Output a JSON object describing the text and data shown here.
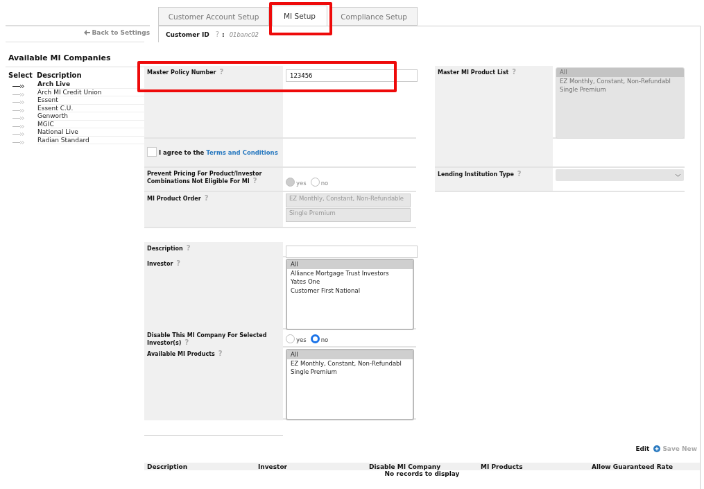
{
  "tabs": [
    {
      "label": "Customer Account Setup",
      "selected": false
    },
    {
      "label": "MI Setup",
      "selected": true
    },
    {
      "label": "Compliance Setup",
      "selected": false
    }
  ],
  "back_link": "Back to Settings",
  "customer_id": {
    "label": "Customer ID",
    "help": "?",
    "separator": ":",
    "value": "01banc02"
  },
  "sidebar": {
    "title": "Available MI Companies",
    "columns": [
      "Select",
      "Description"
    ],
    "items": [
      {
        "label": "Arch Live",
        "selected": true
      },
      {
        "label": "Arch MI Credit Union",
        "selected": false
      },
      {
        "label": "Essent",
        "selected": false
      },
      {
        "label": "Essent C.U.",
        "selected": false
      },
      {
        "label": "Genworth",
        "selected": false
      },
      {
        "label": "MGIC",
        "selected": false
      },
      {
        "label": "National Live",
        "selected": false
      },
      {
        "label": "Radian Standard",
        "selected": false
      }
    ]
  },
  "company_settings": {
    "left": [
      {
        "kind": "text",
        "label": "Master Policy Number",
        "help": "?",
        "value": "123456"
      },
      {
        "kind": "checkbox",
        "text": "I agree to the ",
        "link": "Terms and Conditions",
        "checked": false
      },
      {
        "kind": "radio",
        "label": "Prevent Pricing For Product/Investor Combinations Not Eligible For MI",
        "help": "?",
        "disabled": true,
        "options": [
          {
            "label": "yes",
            "selected": true
          },
          {
            "label": "no",
            "selected": false
          }
        ]
      },
      {
        "kind": "order",
        "label": "MI Product Order",
        "help": "?",
        "items": [
          "EZ Monthly, Constant, Non-Refundable",
          "Single Premium"
        ]
      }
    ],
    "right": [
      {
        "kind": "listbox",
        "label": "Master MI Product List",
        "help": "?",
        "disabled": true,
        "options": [
          {
            "label": "All",
            "selected": true
          },
          {
            "label": "EZ Monthly, Constant, Non-Refundabl",
            "selected": false
          },
          {
            "label": "Single Premium",
            "selected": false
          }
        ]
      },
      {
        "kind": "blank"
      },
      {
        "kind": "select",
        "label": "Lending Institution Type",
        "help": "?",
        "disabled": true
      }
    ]
  },
  "investor_settings": [
    {
      "kind": "text",
      "label": "Description",
      "help": "?"
    },
    {
      "kind": "listbox",
      "label": "Investor",
      "help": "?",
      "disabled": false,
      "options": [
        {
          "label": "All",
          "selected": true
        },
        {
          "label": "Alliance Mortgage Trust Investors",
          "selected": false
        },
        {
          "label": "Yates One",
          "selected": false
        },
        {
          "label": "Customer First National",
          "selected": false
        }
      ]
    },
    {
      "kind": "radio",
      "label": "Disable This MI Company For Selected Investor(s)",
      "help": "?",
      "disabled": false,
      "options": [
        {
          "label": "yes",
          "selected": false
        },
        {
          "label": "no",
          "selected": true
        }
      ]
    },
    {
      "kind": "listbox",
      "label": "Available MI Products",
      "help": "?",
      "disabled": false,
      "options": [
        {
          "label": "All",
          "selected": true
        },
        {
          "label": "EZ Monthly, Constant, Non-Refundabl",
          "selected": false
        },
        {
          "label": "Single Premium",
          "selected": false
        }
      ]
    }
  ],
  "actions": [
    {
      "kind": "plain",
      "label": "Edit",
      "disabled": false
    },
    {
      "kind": "add",
      "label": "Save New",
      "disabled": true
    }
  ],
  "table": {
    "columns": [
      "Description",
      "Investor",
      "Disable MI Company",
      "MI Products",
      "Allow Guaranteed Rate"
    ],
    "empty_message": "No records to display"
  }
}
